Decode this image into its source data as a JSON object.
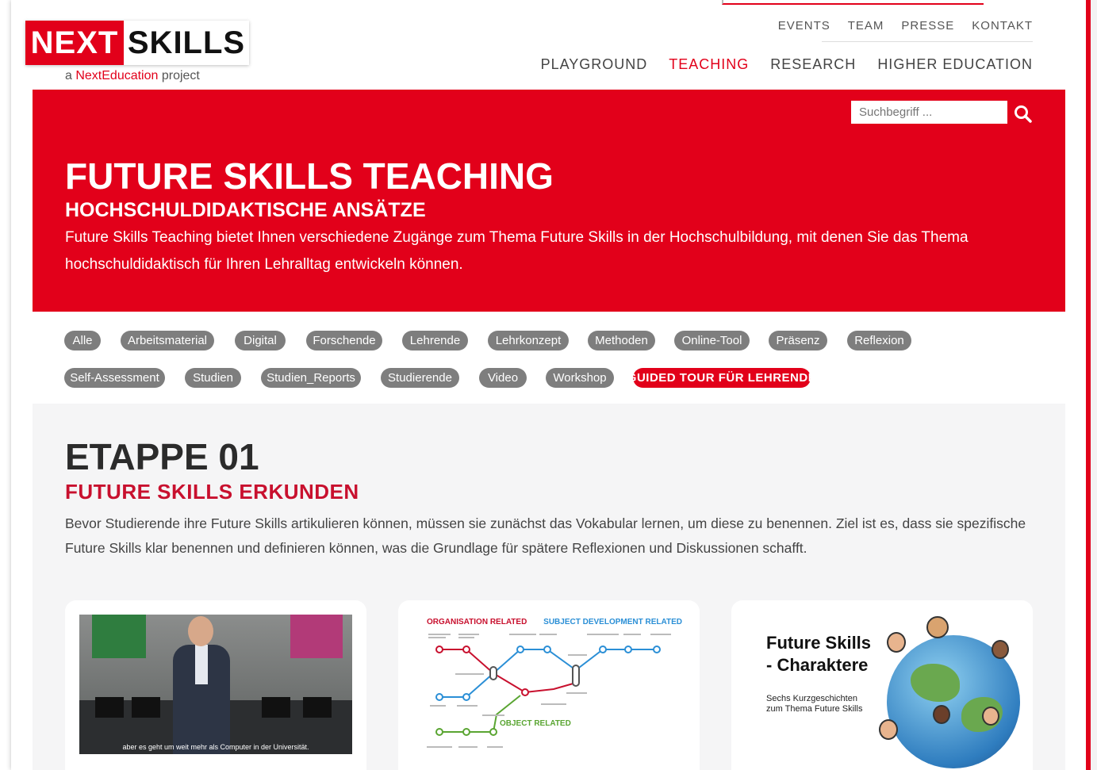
{
  "logo": {
    "next": "NEXT",
    "skills": "SKILLS"
  },
  "tagline": {
    "prefix": "a ",
    "brand": "NextEducation",
    "suffix": " project"
  },
  "top_nav": [
    "EVENTS",
    "TEAM",
    "PRESSE",
    "KONTAKT"
  ],
  "main_nav": [
    "PLAYGROUND",
    "TEACHING",
    "RESEARCH",
    "HIGHER EDUCATION"
  ],
  "main_nav_active": "TEACHING",
  "search": {
    "placeholder": "Suchbegriff ...",
    "icon": "search-icon"
  },
  "hero": {
    "title": "FUTURE SKILLS TEACHING",
    "subtitle": "HOCHSCHULDIDAKTISCHE ANSÄTZE",
    "text": "Future Skills Teaching bietet Ihnen verschiedene Zugänge zum Thema Future Skills in der Hochschulbildung, mit denen Sie das Thema hochschuldidaktisch für Ihren Lehralltag entwickeln können."
  },
  "filters": [
    "Alle",
    "Arbeitsmaterial",
    "Digital",
    "Forschende",
    "Lehrende",
    "Lehrkonzept",
    "Methoden",
    "Online-Tool",
    "Präsenz",
    "Reflexion",
    "Self-Assessment",
    "Studien",
    "Studien_Reports",
    "Studierende",
    "Video",
    "Workshop",
    "GUIDED TOUR FÜR LEHRENDE"
  ],
  "etappe": {
    "title": "ETAPPE 01",
    "subtitle": "FUTURE SKILLS ERKUNDEN",
    "text": "Bevor Studierende ihre Future Skills artikulieren können, müssen sie zunächst das Vokabular lernen, um diese zu benennen. Ziel ist es, dass sie spezifische Future Skills klar benennen und definieren können, was die Grundlage für spätere Reflexionen und Diskussionen schafft."
  },
  "cards": {
    "video_caption": "aber es geht um weit mehr als Computer in der Universität.",
    "diagram": {
      "label_red": "ORGANISATION RELATED",
      "label_blue": "SUBJECT DEVELOPMENT RELATED",
      "label_green": "OBJECT RELATED"
    },
    "characters": {
      "title_line1": "Future Skills",
      "title_line2": "- Charaktere",
      "sub_line1": "Sechs Kurzgeschichten",
      "sub_line2": "zum Thema Future Skills"
    }
  },
  "colors": {
    "brand_red": "#e2001a",
    "pill_grey": "#7e7e7e",
    "content_bg": "#f5f5f6"
  }
}
